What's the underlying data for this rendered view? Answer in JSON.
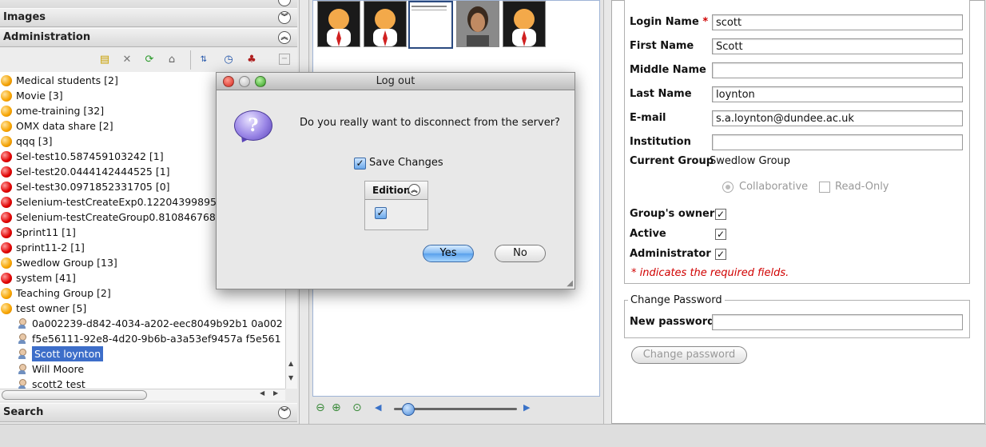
{
  "left_panel": {
    "sections": {
      "images": "Images",
      "administration": "Administration",
      "search": "Search"
    },
    "tree": [
      {
        "label": "Medical students [2]",
        "icon": "group-mixed-icon"
      },
      {
        "label": "Movie [3]",
        "icon": "group-orange-icon"
      },
      {
        "label": "ome-training [32]",
        "icon": "group-orange-icon"
      },
      {
        "label": "OMX data share [2]",
        "icon": "group-orange-icon"
      },
      {
        "label": "qqq [3]",
        "icon": "group-mixed-icon"
      },
      {
        "label": "Sel-test10.587459103242 [1]",
        "icon": "group-red-icon"
      },
      {
        "label": "Sel-test20.0444142444525 [1]",
        "icon": "group-red-icon"
      },
      {
        "label": "Sel-test30.0971852331705 [0]",
        "icon": "group-red-icon"
      },
      {
        "label": "Selenium-testCreateExp0.12204399895 [1",
        "icon": "group-red-icon"
      },
      {
        "label": "Selenium-testCreateGroup0.81084676898",
        "icon": "group-red-icon"
      },
      {
        "label": "Sprint11 [1]",
        "icon": "group-red-icon"
      },
      {
        "label": "sprint11-2 [1]",
        "icon": "group-red-icon"
      },
      {
        "label": "Swedlow Group [13]",
        "icon": "group-orange-icon"
      },
      {
        "label": "system [41]",
        "icon": "group-red-icon"
      },
      {
        "label": "Teaching Group [2]",
        "icon": "group-orange-icon"
      },
      {
        "label": "test owner [5]",
        "icon": "group-orange-icon"
      }
    ],
    "users": [
      {
        "label": "0a002239-d842-4034-a202-eec8049b92b1 0a002"
      },
      {
        "label": "f5e56111-92e8-4d20-9b6b-a3a53ef9457a f5e561"
      },
      {
        "label": "Scott loynton",
        "selected": true
      },
      {
        "label": "Will Moore"
      },
      {
        "label": "scott2 test"
      }
    ]
  },
  "form": {
    "login_name_label": "Login Name",
    "required_star": "*",
    "login_name_value": "scott",
    "first_name_label": "First Name",
    "first_name_value": "Scott",
    "middle_name_label": "Middle Name",
    "middle_name_value": "",
    "last_name_label": "Last Name",
    "last_name_value": "loynton",
    "email_label": "E-mail",
    "email_value": "s.a.loynton@dundee.ac.uk",
    "institution_label": "Institution",
    "institution_value": "",
    "current_group_label": "Current Group",
    "current_group_value": "Swedlow Group",
    "collaborative_label": "Collaborative",
    "read_only_label": "Read-Only",
    "group_owner_label": "Group's owner",
    "active_label": "Active",
    "administrator_label": "Administrator",
    "check_mark": "✓",
    "required_note": "* indicates the required fields.",
    "change_password_title": "Change Password",
    "new_password_label": "New password",
    "change_password_button": "Change password"
  },
  "dialog": {
    "title": "Log out",
    "question_glyph": "?",
    "message": "Do you really want to disconnect from the server?",
    "save_changes_label": "Save Changes",
    "edition_label": "Edition",
    "yes_label": "Yes",
    "no_label": "No"
  },
  "colors": {
    "selection": "#3d6ec9",
    "required": "#d00000",
    "default_button": "#5aa0ec"
  }
}
